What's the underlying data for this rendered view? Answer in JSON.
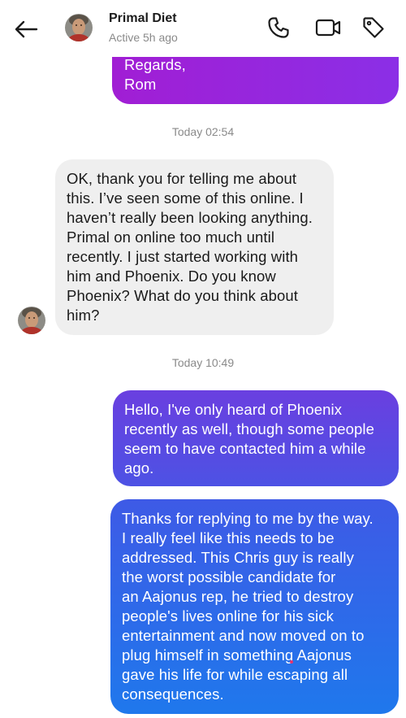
{
  "header": {
    "back_icon": "arrow-left-icon",
    "contact_name": "Primal Diet",
    "status": "Active 5h ago",
    "icons": [
      "phone-icon",
      "video-camera-icon",
      "tag-icon"
    ]
  },
  "messages": [
    {
      "direction": "outgoing",
      "lines": [
        "Regards,",
        "Rom"
      ]
    },
    {
      "type": "timestamp",
      "text": "Today 02:54"
    },
    {
      "direction": "incoming",
      "lines": [
        "OK, thank you for telling me about",
        "this. I’ve seen some of this online. I",
        "haven’t really been looking anything.",
        "Primal on online too much until",
        "recently. I just started working with",
        "him and Phoenix. Do you know",
        "Phoenix? What do you think about",
        "him?"
      ]
    },
    {
      "type": "timestamp",
      "text": "Today 10:49"
    },
    {
      "direction": "outgoing",
      "lines": [
        "Hello, I've only heard of Phoenix",
        "recently as well, though some people",
        "seem to have contacted him a while",
        "ago."
      ]
    },
    {
      "direction": "outgoing",
      "lines": [
        "Thanks for replying to me by the way.",
        "I really feel like this needs to be",
        "addressed. This Chris guy is really",
        "the worst possible candidate for",
        "an Aajonus rep, he tried to destroy",
        "people's lives online for his sick",
        "entertainment and now moved on to",
        "plug himself in something Aajonus",
        "gave his life for while escaping all",
        "consequences."
      ]
    }
  ],
  "colors": {
    "outgoing_purple": "#a11ed4",
    "outgoing_indigo": "#5a48e2",
    "outgoing_blue": "#1f78ec",
    "incoming_bg": "#efefef",
    "timestamp_text": "#8a8a8a"
  }
}
